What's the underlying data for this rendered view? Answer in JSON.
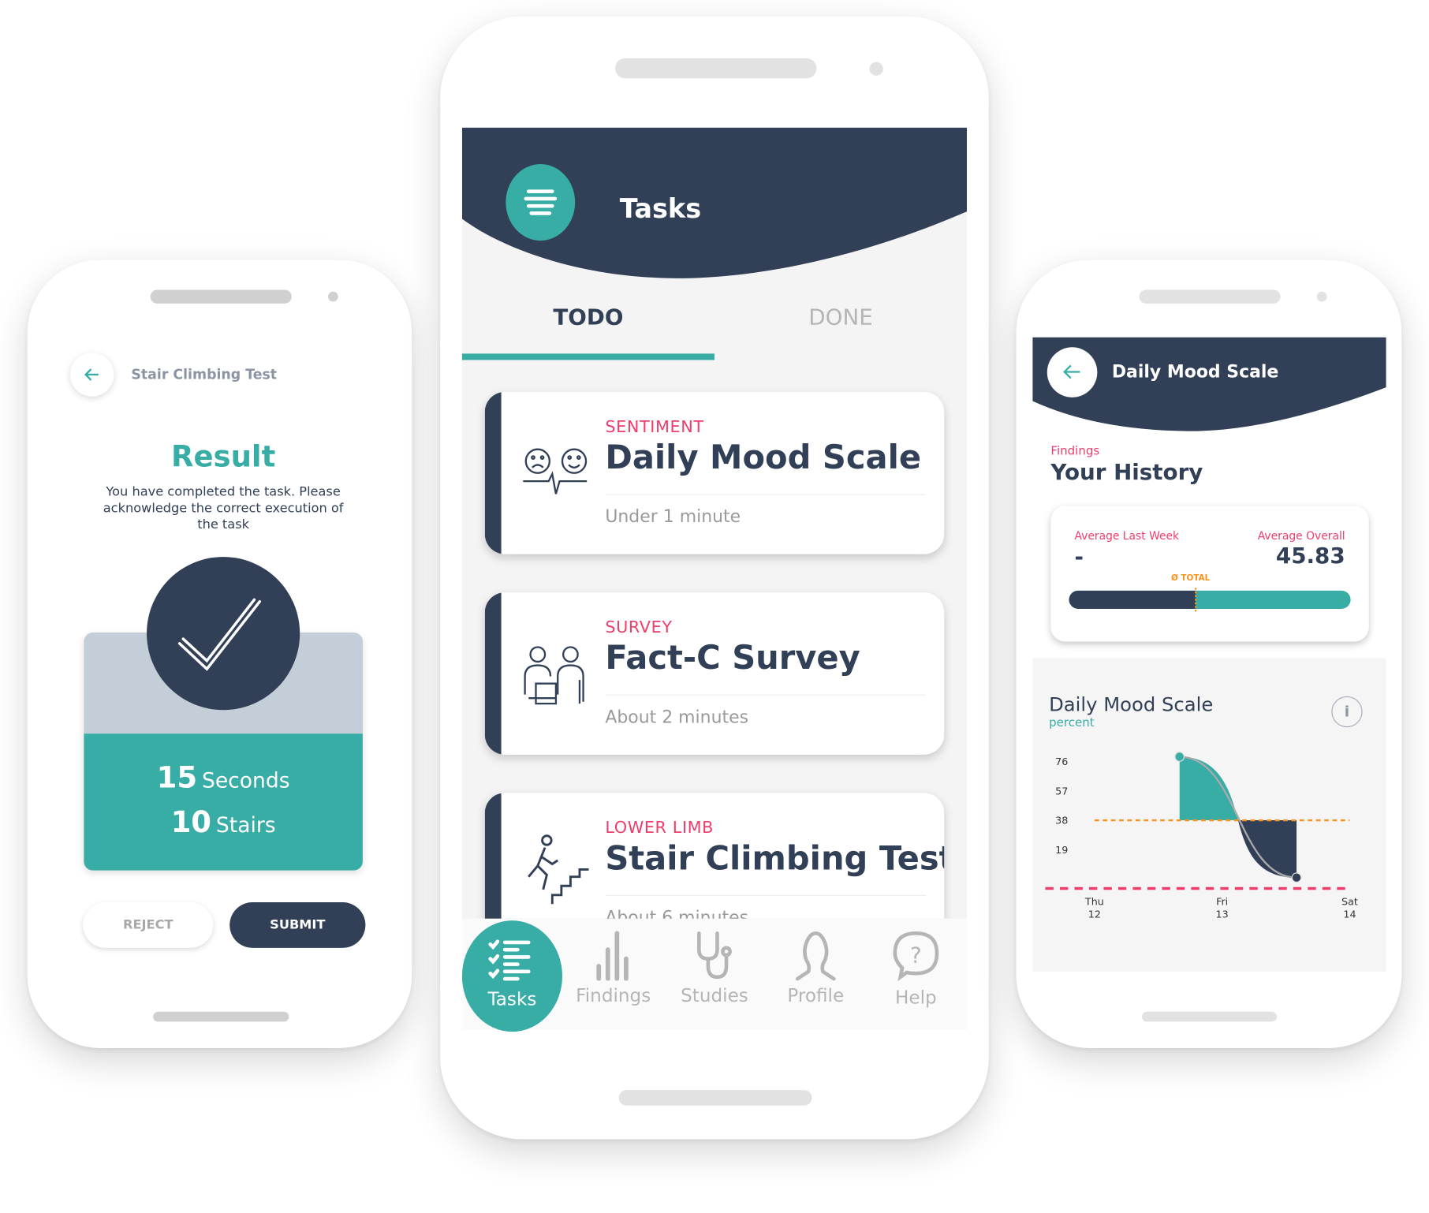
{
  "colors": {
    "navy": "#324057",
    "teal": "#38ada5",
    "pink": "#ef3d6b",
    "orange": "#f7931e",
    "gray": "#b5b5b5"
  },
  "left_phone": {
    "header_title": "Stair Climbing Test",
    "back_icon": "arrow-left-icon",
    "result_title": "Result",
    "result_text": "You have completed the task. Please acknowledge the correct execution of the task",
    "check_icon": "checkmark-icon",
    "seconds_value": "15",
    "seconds_label": "Seconds",
    "stairs_value": "10",
    "stairs_label": "Stairs",
    "reject_label": "REJECT",
    "submit_label": "SUBMIT"
  },
  "center_phone": {
    "menu_icon": "menu-icon",
    "title": "Tasks",
    "tabs": [
      {
        "label": "TODO",
        "active": true
      },
      {
        "label": "DONE",
        "active": false
      }
    ],
    "tasks": [
      {
        "category": "SENTIMENT",
        "title": "Daily Mood Scale",
        "duration": "Under 1 minute",
        "icon": "mood-faces-icon"
      },
      {
        "category": "SURVEY",
        "title": "Fact-C Survey",
        "duration": "About 2 minutes",
        "icon": "people-survey-icon"
      },
      {
        "category": "LOWER LIMB",
        "title": "Stair Climbing Test",
        "duration": "About 6 minutes",
        "icon": "stair-climbing-icon"
      }
    ],
    "nav": [
      {
        "label": "Tasks",
        "icon": "task-list-icon",
        "active": true
      },
      {
        "label": "Findings",
        "icon": "bar-chart-icon",
        "active": false
      },
      {
        "label": "Studies",
        "icon": "stethoscope-icon",
        "active": false
      },
      {
        "label": "Profile",
        "icon": "person-icon",
        "active": false
      },
      {
        "label": "Help",
        "icon": "help-bubble-icon",
        "active": false
      }
    ]
  },
  "right_phone": {
    "header_title": "Daily Mood Scale",
    "section_label": "Findings",
    "section_title": "Your History",
    "avg_last_week_label": "Average Last Week",
    "avg_last_week_value": "-",
    "avg_overall_label": "Average Overall",
    "avg_overall_value": "45.83",
    "total_marker_label": "Ø TOTAL",
    "progress_fraction": 0.45,
    "info_icon": "info-icon"
  },
  "chart_data": {
    "type": "area",
    "title": "Daily Mood Scale",
    "ylabel": "percent",
    "y_ticks": [
      "76",
      "57",
      "38",
      "19"
    ],
    "x_ticks": [
      {
        "day": "Thu",
        "date": "12"
      },
      {
        "day": "Fri",
        "date": "13"
      },
      {
        "day": "Sat",
        "date": "14"
      }
    ],
    "points": [
      {
        "x": "Thu 12 16:00",
        "y": 79
      },
      {
        "x": "Fri 13 14:00",
        "y": 1
      }
    ],
    "reference_lines": [
      {
        "y": 38,
        "color": "#f7931e"
      },
      {
        "y": -6,
        "color": "#ef3d6b"
      }
    ],
    "grid": false
  }
}
